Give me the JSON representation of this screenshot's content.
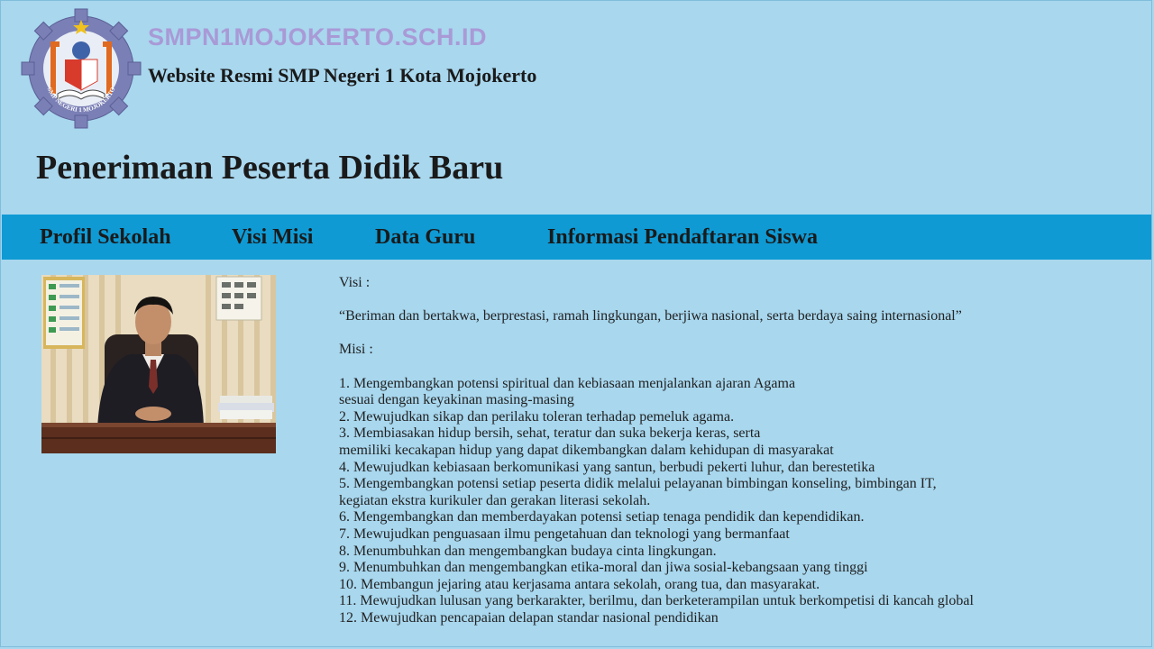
{
  "site": {
    "domain": "SMPN1MOJOKERTO.SCH.ID",
    "subtitle": "Website Resmi SMP Negeri 1 Kota Mojokerto",
    "logo_text": "SMP NEGERI 1 MOJOKERTO"
  },
  "page_title": "Penerimaan Peserta Didik Baru",
  "nav": {
    "items": [
      {
        "label": "Profil Sekolah"
      },
      {
        "label": "Visi Misi"
      },
      {
        "label": "Data Guru"
      },
      {
        "label": "Informasi Pendaftaran Siswa"
      }
    ]
  },
  "content": {
    "visi_heading": "Visi :",
    "visi_text": "“Beriman dan bertakwa, berprestasi, ramah lingkungan, berjiwa nasional, serta berdaya saing internasional”",
    "misi_heading": "Misi :",
    "misi_lines": [
      "1. Mengembangkan potensi spiritual dan kebiasaan menjalankan ajaran Agama",
      "sesuai dengan keyakinan masing-masing",
      "2. Mewujudkan sikap dan perilaku toleran terhadap pemeluk agama.",
      "3. Membiasakan hidup bersih, sehat, teratur dan suka bekerja keras, serta",
      "memiliki kecakapan hidup yang dapat dikembangkan dalam kehidupan di masyarakat",
      "4. Mewujudkan kebiasaan berkomunikasi yang santun, berbudi pekerti luhur, dan berestetika",
      "5. Mengembangkan potensi setiap peserta didik melalui pelayanan bimbingan konseling, bimbingan IT,",
      "kegiatan ekstra kurikuler dan gerakan literasi sekolah.",
      "6. Mengembangkan dan memberdayakan potensi setiap tenaga pendidik dan kependidikan.",
      "7. Mewujudkan penguasaan ilmu pengetahuan dan teknologi yang bermanfaat",
      "8. Menumbuhkan dan mengembangkan budaya cinta lingkungan.",
      "9. Menumbuhkan dan mengembangkan etika-moral dan jiwa sosial-kebangsaan yang tinggi",
      "10. Membangun jejaring atau kerjasama antara sekolah, orang tua, dan masyarakat.",
      "11. Mewujudkan lulusan yang berkarakter, berilmu, dan berketerampilan untuk berkompetisi di kancah global",
      "12. Mewujudkan pencapaian delapan standar nasional pendidikan"
    ]
  },
  "colors": {
    "page_background": "#a8d7ee",
    "navbar": "#0f9ad4",
    "domain_text": "#a99ad6"
  }
}
